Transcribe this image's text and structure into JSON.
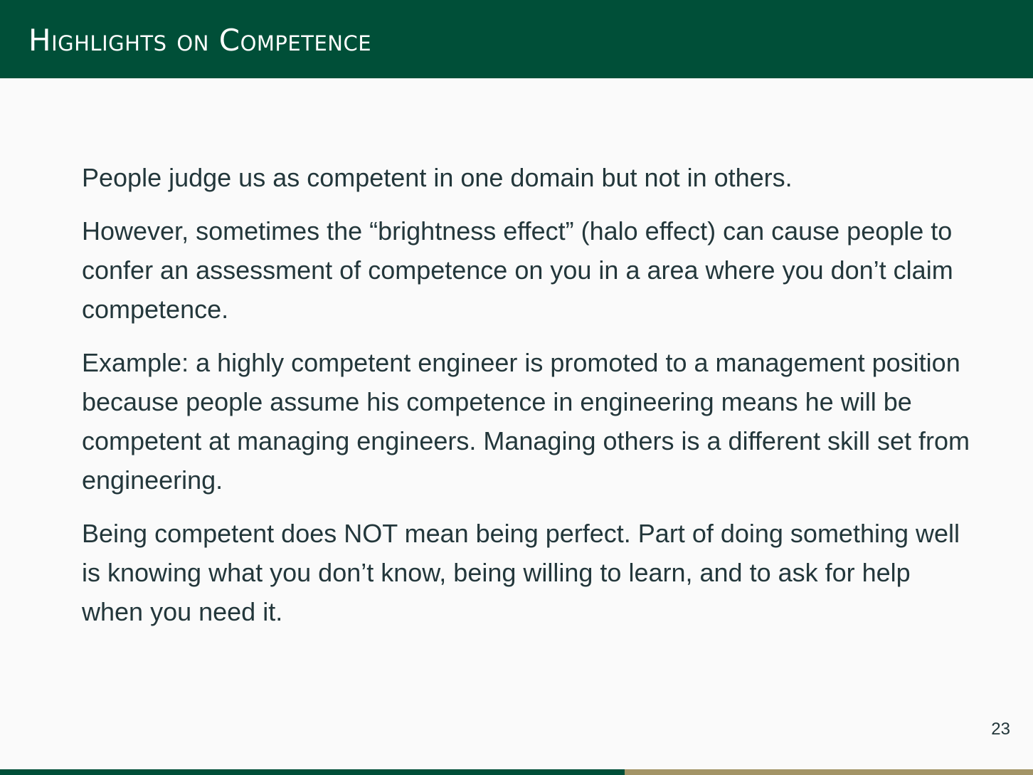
{
  "slide": {
    "title": "Highlights on Competence",
    "paragraphs": [
      "People judge us as competent in one domain but not in others.",
      "However, sometimes the “brightness effect” (halo effect) can cause people to confer an assessment of competence on you in a area where you don’t claim competence.",
      "Example: a highly competent engineer is promoted to a management position because people assume his competence in engineering means he will be competent at managing engineers. Managing others is a different skill set from engineering.",
      "Being competent does NOT mean being perfect. Part of doing something well is knowing what you don’t know, being willing to learn, and to ask for help when you need it."
    ],
    "page_number": "23",
    "progress": 0.605
  },
  "colors": {
    "header_bg": "#004f38",
    "text": "#23373b",
    "progress_track": "#a39466",
    "progress_fill": "#004f38"
  }
}
